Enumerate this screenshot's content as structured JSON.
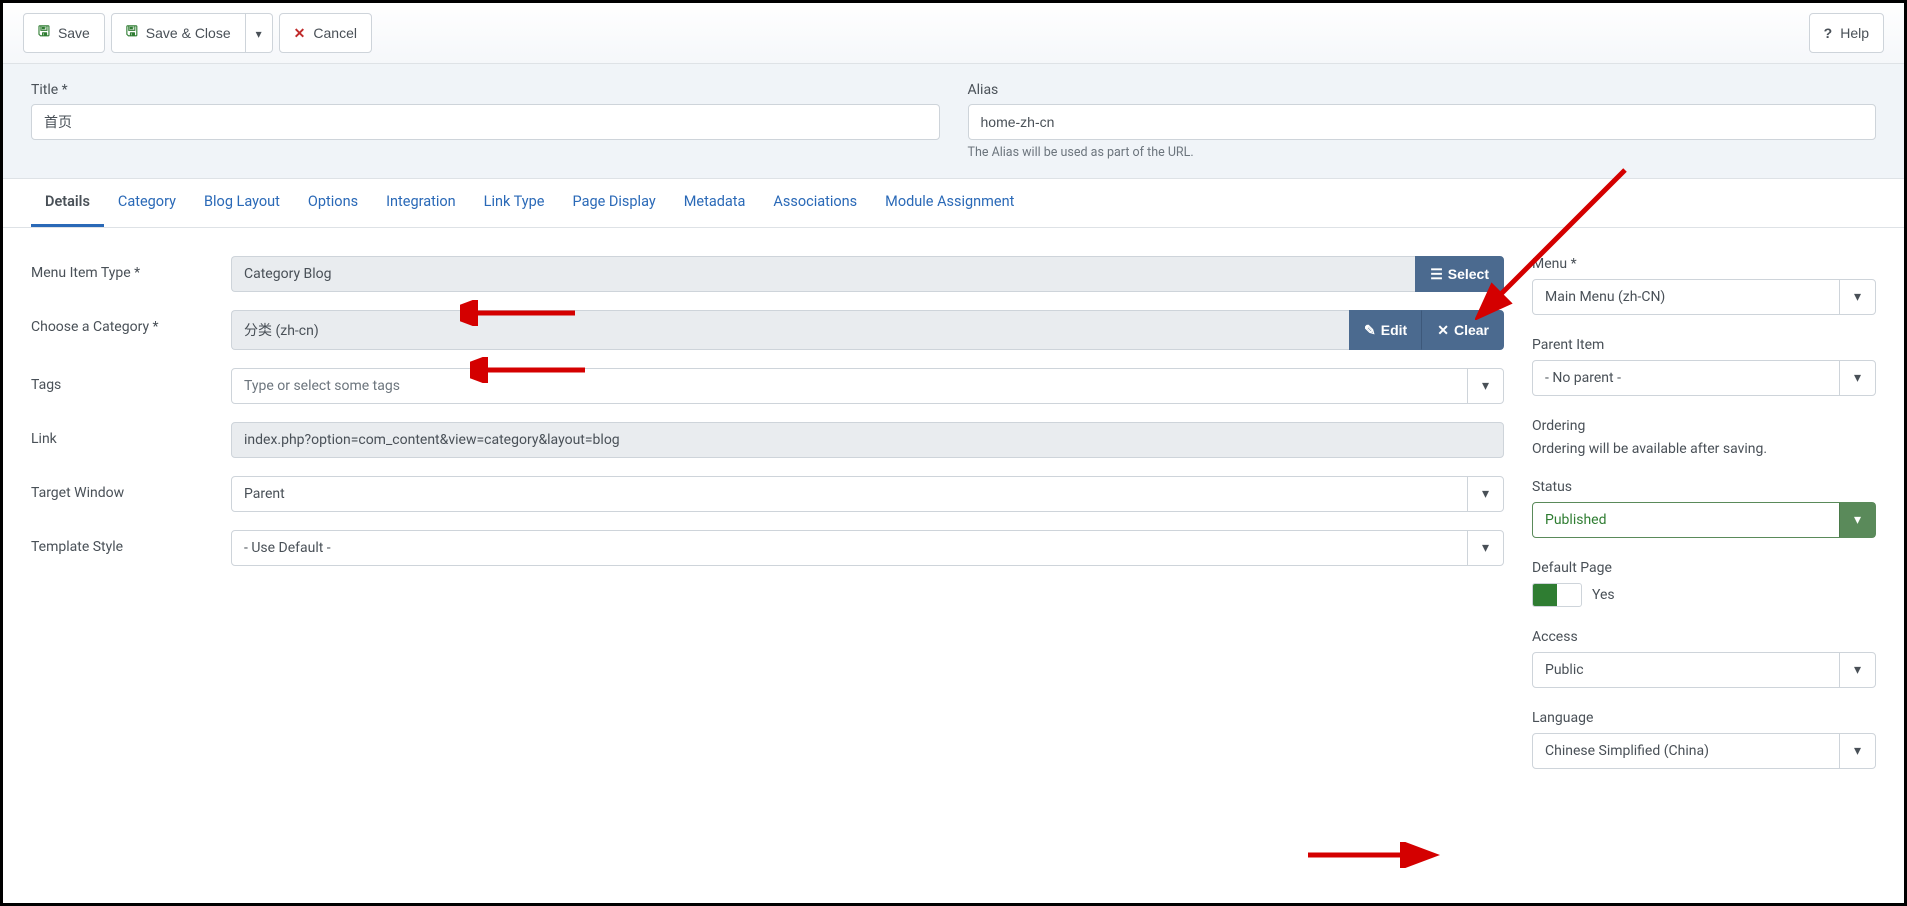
{
  "toolbar": {
    "save": "Save",
    "saveclose": "Save & Close",
    "cancel": "Cancel",
    "help": "Help"
  },
  "header": {
    "titleLabel": "Title *",
    "titleValue": "首页",
    "aliasLabel": "Alias",
    "aliasValue": "home-zh-cn",
    "aliasHelp": "The Alias will be used as part of the URL."
  },
  "tabs": [
    "Details",
    "Category",
    "Blog Layout",
    "Options",
    "Integration",
    "Link Type",
    "Page Display",
    "Metadata",
    "Associations",
    "Module Assignment"
  ],
  "details": {
    "menuItemTypeLabel": "Menu Item Type *",
    "menuItemTypeValue": "Category Blog",
    "selectBtn": "Select",
    "categoryLabel": "Choose a Category *",
    "categoryValue": "分类 (zh-cn)",
    "editBtn": "Edit",
    "clearBtn": "Clear",
    "tagsLabel": "Tags",
    "tagsPlaceholder": "Type or select some tags",
    "linkLabel": "Link",
    "linkValue": "index.php?option=com_content&view=category&layout=blog",
    "targetLabel": "Target Window",
    "targetValue": "Parent",
    "templateLabel": "Template Style",
    "templateValue": "- Use Default -"
  },
  "sidebar": {
    "menuLabel": "Menu *",
    "menuValue": "Main Menu (zh-CN)",
    "parentLabel": "Parent Item",
    "parentValue": "- No parent -",
    "orderingLabel": "Ordering",
    "orderingText": "Ordering will be available after saving.",
    "statusLabel": "Status",
    "statusValue": "Published",
    "defaultPageLabel": "Default Page",
    "defaultPageValue": "Yes",
    "accessLabel": "Access",
    "accessValue": "Public",
    "languageLabel": "Language",
    "languageValue": "Chinese Simplified (China)"
  }
}
